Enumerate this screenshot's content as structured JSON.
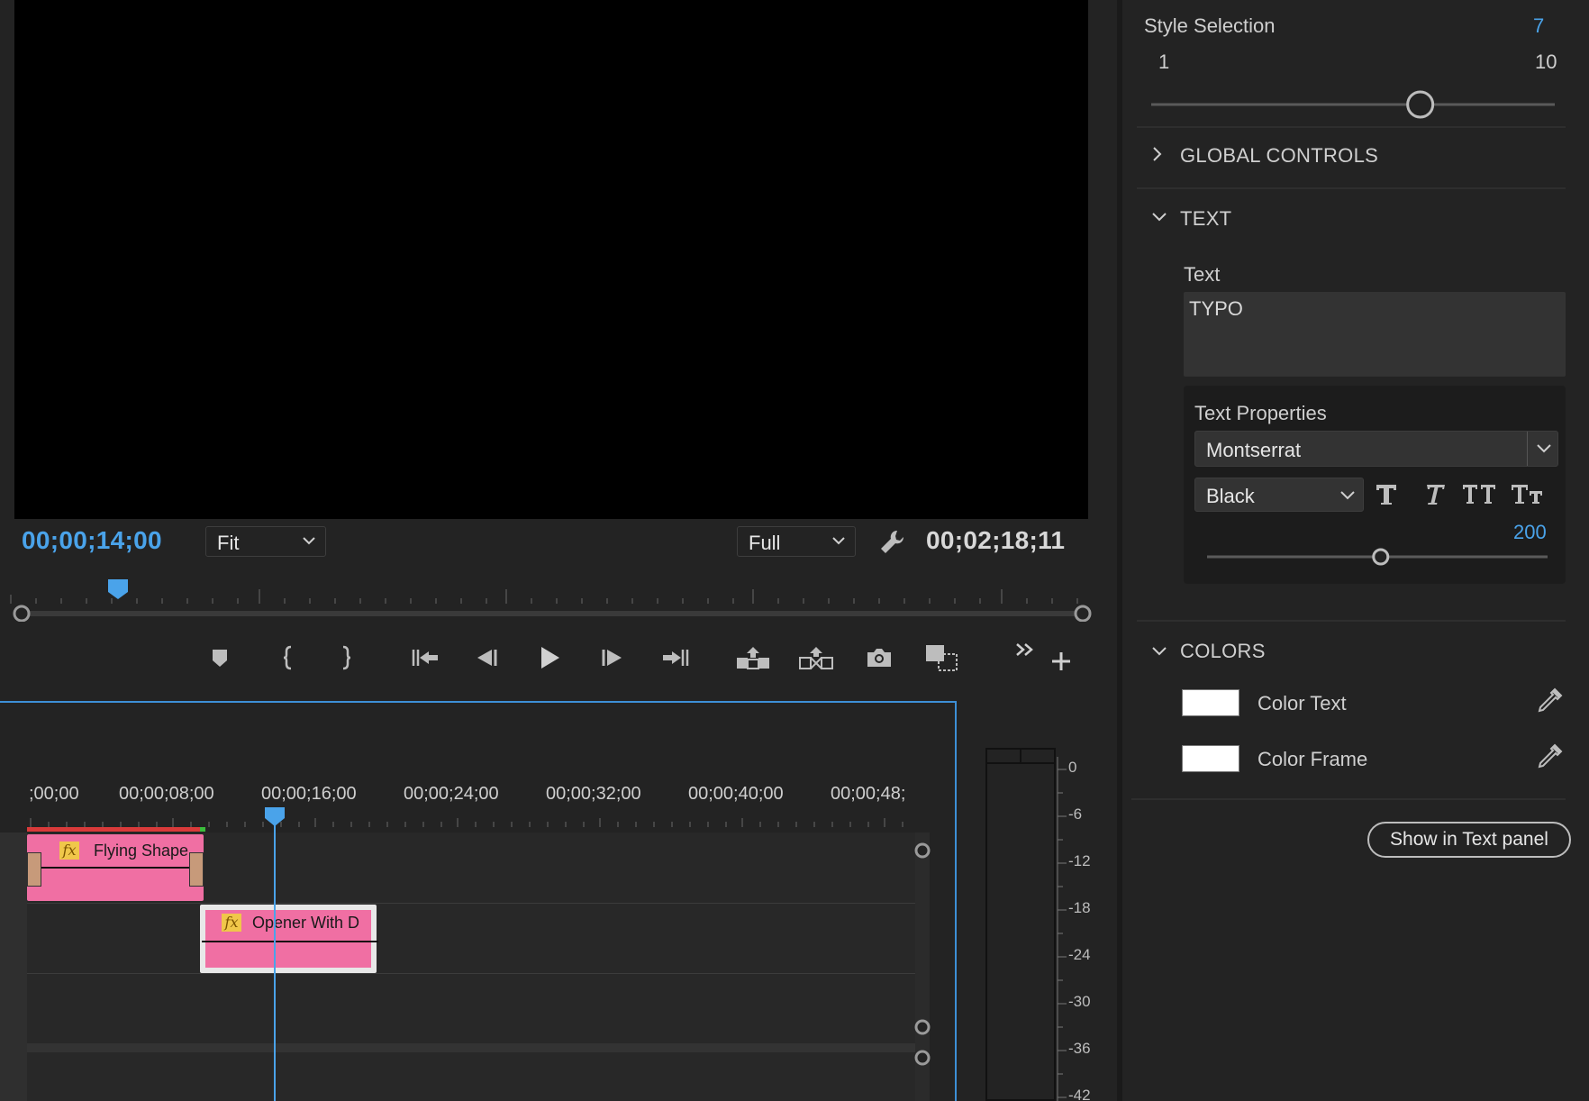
{
  "monitor": {
    "current_timecode": "00;00;14;00",
    "duration_timecode": "00;02;18;11",
    "zoom_value": "Fit",
    "quality_value": "Full"
  },
  "timeline": {
    "ruler_labels": [
      ";00;00",
      "00;00;08;00",
      "00;00;16;00",
      "00;00;24;00",
      "00;00;32;00",
      "00;00;40;00",
      "00;00;48;"
    ],
    "clips": [
      {
        "name": "Flying Shape",
        "fx": "fx"
      },
      {
        "name": "Opener With D",
        "fx": "fx"
      }
    ],
    "meter_db": [
      "0",
      "-6",
      "-12",
      "-18",
      "-24",
      "-30",
      "-36",
      "-42"
    ]
  },
  "panel": {
    "style_selection": {
      "label": "Style Selection",
      "value": "7",
      "min": "1",
      "max": "10"
    },
    "global_controls": "GLOBAL CONTROLS",
    "text_section": "TEXT",
    "text_label": "Text",
    "text_value": "TYPO",
    "text_properties": {
      "label": "Text Properties",
      "font": "Montserrat",
      "weight": "Black",
      "size": "200",
      "size_fraction": 0.51
    },
    "colors_section": "COLORS",
    "color_text_label": "Color Text",
    "color_frame_label": "Color Frame",
    "show_button": "Show in Text panel"
  },
  "colors": {
    "accent": "#4aa3ea",
    "clip": "#f06fa3",
    "fx_badge": "#f0c74a",
    "swatch": "#ffffff"
  }
}
